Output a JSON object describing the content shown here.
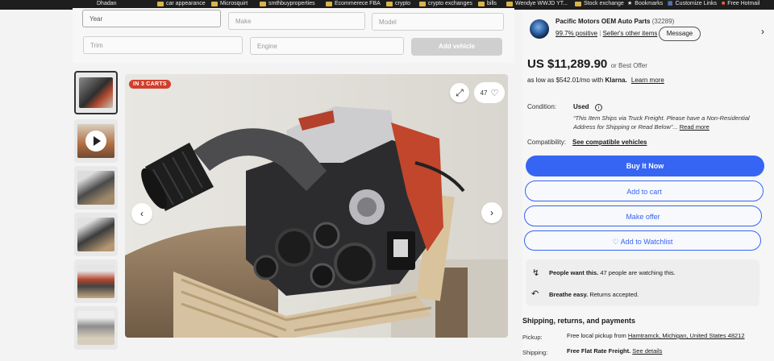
{
  "bookmarks": [
    {
      "label": "Dhadan"
    },
    {
      "label": "car appearance"
    },
    {
      "label": "Microsquirt"
    },
    {
      "label": "smthbuyproperties"
    },
    {
      "label": "Ecommerece FBA"
    },
    {
      "label": "crypto"
    },
    {
      "label": "crypto exchanges"
    },
    {
      "label": "bills"
    },
    {
      "label": "Wendye WWJD YT..."
    },
    {
      "label": "Stock exchange"
    },
    {
      "label": "Bookmarks"
    },
    {
      "label": "Customize Links"
    },
    {
      "label": "Free Hotmail"
    }
  ],
  "vehicle_form": {
    "year": "Year",
    "make": "Make",
    "model": "Model",
    "trim": "Trim",
    "engine": "Engine",
    "add_vehicle": "Add vehicle"
  },
  "listing": {
    "badge": "IN 3 CARTS",
    "watch_count": "47"
  },
  "seller": {
    "name": "Pacific Motors OEM Auto Parts",
    "feedback_count": "(32289)",
    "positive": "99.7% positive",
    "other_items": "Seller's other items",
    "message": "Message"
  },
  "price": {
    "amount": "US $11,289.90",
    "best_offer": "or Best Offer",
    "installments_prefix": "as low as $542.01/mo with",
    "klarna": "Klarna.",
    "learn_more": "Learn more"
  },
  "condition": {
    "label": "Condition:",
    "value": "Used",
    "note_line1": "“This Item Ships via Truck Freight. Please have a Non-Residential",
    "note_line2": "Address for Shipping or Read Below”...",
    "read_more": "Read more"
  },
  "compatibility": {
    "label": "Compatibility:",
    "link": "See compatible vehicles"
  },
  "actions": {
    "buy_now": "Buy It Now",
    "add_to_cart": "Add to cart",
    "make_offer": "Make offer",
    "add_to_watchlist": "♡ Add to Watchlist"
  },
  "info": {
    "people_want_bold": "People want this.",
    "people_want_rest": "47 people are watching this.",
    "breathe_bold": "Breathe easy.",
    "breathe_rest": "Returns accepted."
  },
  "shipping": {
    "heading": "Shipping, returns, and payments",
    "pickup_label": "Pickup:",
    "pickup_text": "Free local pickup from",
    "pickup_location": "Hamtramck, Michigan, United States 48212",
    "shipping_label": "Shipping:",
    "shipping_text": "Free Flat Rate Freight.",
    "see_details": "See details"
  },
  "colors": {
    "primary_blue": "#3665f3",
    "badge_red": "#d13f2d"
  },
  "icons": [
    "expand-icon",
    "heart-icon",
    "chevron-left-icon",
    "chevron-right-icon",
    "play-icon",
    "lightning-icon",
    "return-icon",
    "info-icon",
    "chevron-right-icon"
  ]
}
